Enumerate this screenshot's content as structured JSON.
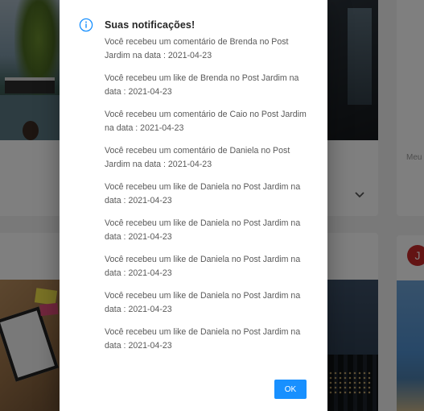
{
  "background": {
    "label_partial": "Meu",
    "avatar_initial": "J"
  },
  "dialog": {
    "icon": "info-circle-icon",
    "title": "Suas notificações!",
    "notifications": [
      "Você recebeu um comentário de Brenda no Post Jardim na data : 2021-04-23",
      "Você recebeu um like de Brenda no Post Jardim na data : 2021-04-23",
      "Você recebeu um comentário de Caio no Post Jardim na data : 2021-04-23",
      "Você recebeu um comentário de Daniela no Post Jardim na data : 2021-04-23",
      "Você recebeu um like de Daniela no Post Jardim na data : 2021-04-23",
      "Você recebeu um like de Daniela no Post Jardim na data : 2021-04-23",
      "Você recebeu um like de Daniela no Post Jardim na data : 2021-04-23",
      "Você recebeu um like de Daniela no Post Jardim na data : 2021-04-23",
      "Você recebeu um like de Daniela no Post Jardim na data : 2021-04-23"
    ],
    "ok_label": "OK"
  },
  "colors": {
    "accent": "#1890ff",
    "avatar": "#c62828",
    "overlay": "rgba(0,0,0,0.5)"
  }
}
